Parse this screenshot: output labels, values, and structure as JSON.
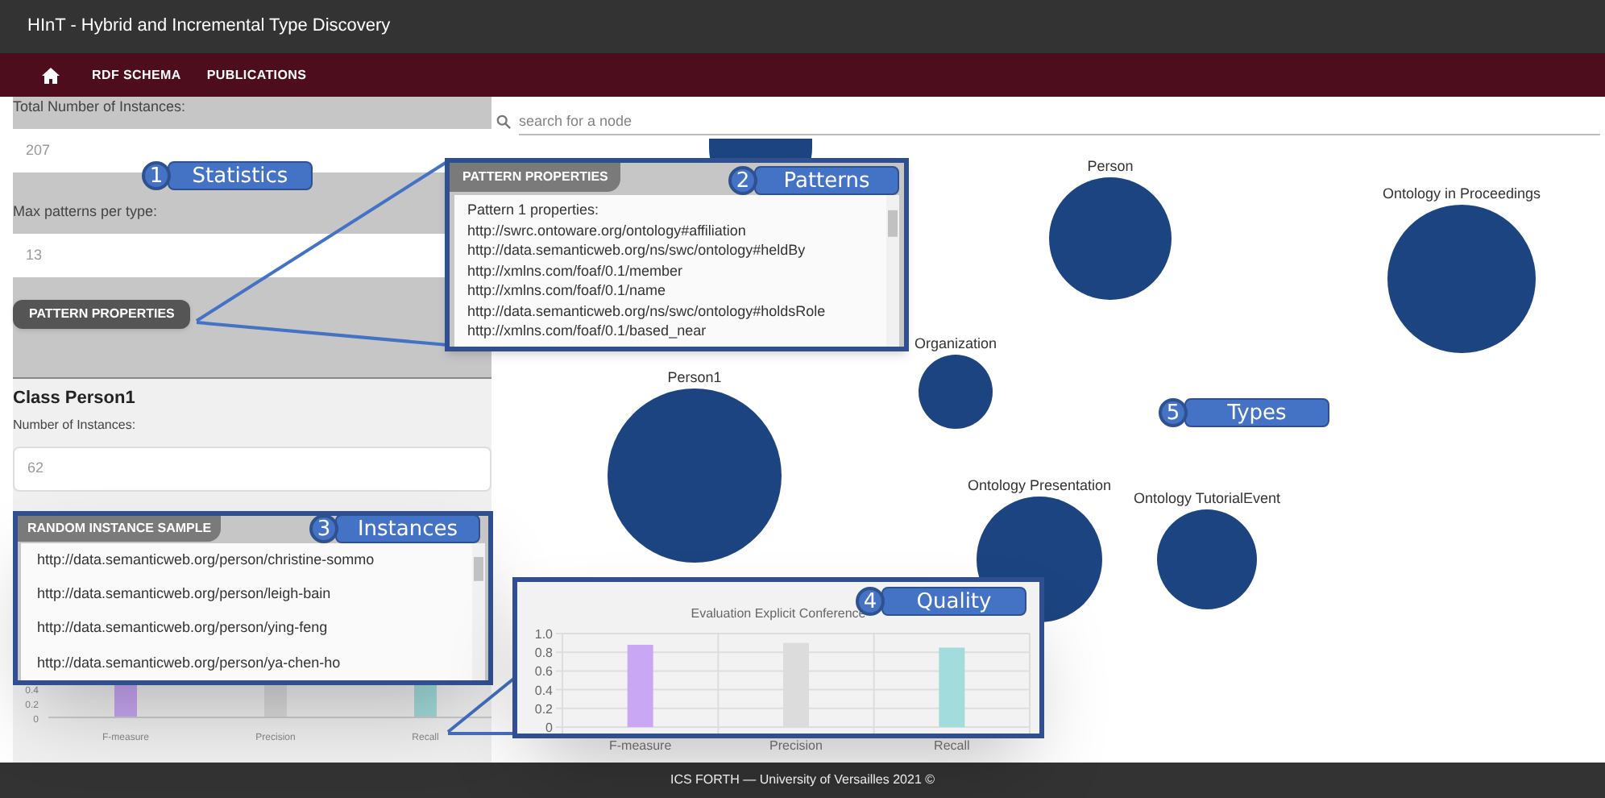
{
  "window": {
    "title": "HInT - Hybrid and Incremental Type Discovery"
  },
  "nav": {
    "items": [
      {
        "kind": "home"
      },
      {
        "kind": "link",
        "label": "RDF SCHEMA"
      },
      {
        "kind": "link",
        "label": "PUBLICATIONS"
      }
    ]
  },
  "statistics": {
    "fields": [
      {
        "label": "Total Number of Instances:",
        "value": "207"
      },
      {
        "label": "Max patterns per type:",
        "value": "13"
      }
    ],
    "button": "PATTERN PROPERTIES"
  },
  "class_panel": {
    "title": "Class Person1",
    "label": "Number of Instances:",
    "value": "62"
  },
  "sidebar_chart": {
    "yticks": [
      "0.4",
      "0.2",
      "0"
    ],
    "categories": [
      "F-measure",
      "Precision",
      "Recall"
    ]
  },
  "search": {
    "placeholder": "search for a node"
  },
  "graph": {
    "nodes": [
      {
        "kind": "unlabeled"
      },
      {
        "kind": "labeled",
        "label": "Person"
      },
      {
        "kind": "labeled",
        "label": "Ontology in Proceedings"
      },
      {
        "kind": "labeled",
        "label": "Organization"
      },
      {
        "kind": "labeled",
        "label": "Person1"
      },
      {
        "kind": "labeled",
        "label": "Ontology Presentation"
      },
      {
        "kind": "labeled",
        "label": "Ontology TutorialEvent"
      }
    ]
  },
  "patterns_popup": {
    "header": "PATTERN PROPERTIES",
    "lines": [
      "Pattern 1 properties:",
      "http://swrc.ontoware.org/ontology#affiliation",
      "http://data.semanticweb.org/ns/swc/ontology#heldBy",
      "http://xmlns.com/foaf/0.1/member",
      "http://xmlns.com/foaf/0.1/name",
      "http://data.semanticweb.org/ns/swc/ontology#holdsRole",
      "http://xmlns.com/foaf/0.1/based_near"
    ]
  },
  "instances_popup": {
    "header": "RANDOM INSTANCE SAMPLE",
    "items": [
      "http://data.semanticweb.org/person/christine-sommo",
      "http://data.semanticweb.org/person/leigh-bain",
      "http://data.semanticweb.org/person/ying-feng",
      "http://data.semanticweb.org/person/ya-chen-ho"
    ]
  },
  "quality_popup": {
    "chart_data": {
      "type": "bar",
      "title": "Evaluation Explicit Conference",
      "categories": [
        "F-measure",
        "Precision",
        "Recall"
      ],
      "series": [
        {
          "color": "#c9a7f5",
          "values": [
            0.88,
            null,
            null
          ]
        },
        {
          "color": "#dcdcdc",
          "values": [
            null,
            0.9,
            null
          ]
        },
        {
          "color": "#a3dcdc",
          "values": [
            null,
            null,
            0.85
          ]
        }
      ],
      "grid": true,
      "ylim": [
        0,
        1
      ],
      "yticks": [
        {
          "value": 0,
          "label": "0"
        },
        {
          "value": 0.2,
          "label": "0.2"
        },
        {
          "value": 0.4,
          "label": "0.4"
        },
        {
          "value": 0.6,
          "label": "0.6"
        },
        {
          "value": 0.8,
          "label": "0.8"
        },
        {
          "value": 1,
          "label": "1.0"
        }
      ]
    }
  },
  "callouts": [
    {
      "number": "1",
      "label": "Statistics"
    },
    {
      "number": "2",
      "label": "Patterns"
    },
    {
      "number": "3",
      "label": "Instances"
    },
    {
      "number": "4",
      "label": "Quality"
    },
    {
      "number": "5",
      "label": "Types"
    }
  ],
  "footer": "ICS FORTH — University of Versailles 2021 ©"
}
